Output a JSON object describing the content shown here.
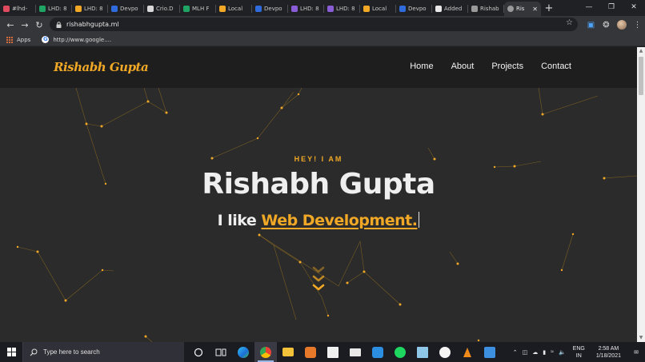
{
  "browser": {
    "tabs": [
      {
        "label": "#lhd-",
        "color": "#e04a5f"
      },
      {
        "label": "LHD: 8",
        "color": "#1fa463"
      },
      {
        "label": "LHD: 8",
        "color": "#f0a826"
      },
      {
        "label": "Devpo",
        "color": "#2f6bdb"
      },
      {
        "label": "Crio.D",
        "color": "#d9d9d9"
      },
      {
        "label": "MLH F",
        "color": "#1fa463"
      },
      {
        "label": "Local",
        "color": "#f0a826"
      },
      {
        "label": "Devpo",
        "color": "#2f6bdb"
      },
      {
        "label": "LHD: 8",
        "color": "#8a5cd6"
      },
      {
        "label": "LHD: 8",
        "color": "#8a5cd6"
      },
      {
        "label": "Local",
        "color": "#f0a826"
      },
      {
        "label": "Devpo",
        "color": "#2f6bdb"
      },
      {
        "label": "Added",
        "color": "#e8e8e8"
      },
      {
        "label": "Rishab",
        "color": "#9a9a9a"
      }
    ],
    "active_tab": {
      "label": "Ris",
      "close": "✕"
    },
    "new_tab": "+",
    "window_controls": {
      "minimize": "—",
      "maximize": "❐",
      "close": "✕"
    },
    "url": "rishabhgupta.ml",
    "bookmarks": [
      {
        "label": "Apps"
      },
      {
        "label": "http://www.google...."
      }
    ]
  },
  "site": {
    "logo": "Rishabh Gupta",
    "nav": [
      "Home",
      "About",
      "Projects",
      "Contact"
    ],
    "eyebrow": "HEY! I AM",
    "name": "Rishabh Gupta",
    "tagline_prefix": "I like ",
    "tagline_typed": "Web Development.",
    "accent": "#f0a826"
  },
  "taskbar": {
    "search_placeholder": "Type here to search",
    "lang_line1": "ENG",
    "lang_line2": "IN",
    "time": "2:58 AM",
    "date": "1/18/2021"
  }
}
